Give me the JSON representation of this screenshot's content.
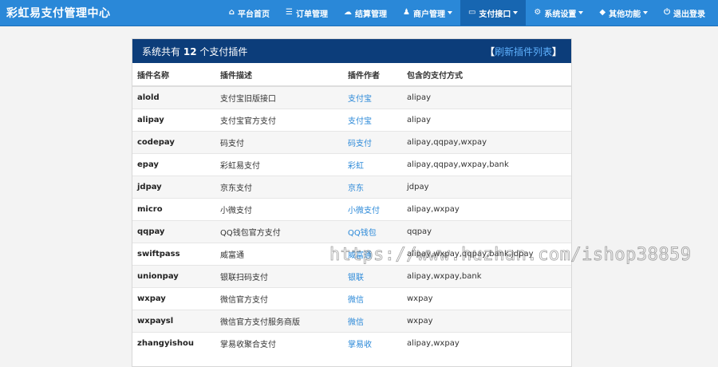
{
  "brand": "彩虹易支付管理中心",
  "nav": [
    {
      "icon": "⌂",
      "label": "平台首页",
      "caret": false,
      "active": false
    },
    {
      "icon": "☰",
      "label": "订单管理",
      "caret": false,
      "active": false
    },
    {
      "icon": "☁",
      "label": "结算管理",
      "caret": false,
      "active": false
    },
    {
      "icon": "♟",
      "label": "商户管理",
      "caret": true,
      "active": false
    },
    {
      "icon": "▭",
      "label": "支付接口",
      "caret": true,
      "active": true
    },
    {
      "icon": "⚙",
      "label": "系统设置",
      "caret": true,
      "active": false
    },
    {
      "icon": "◆",
      "label": "其他功能",
      "caret": true,
      "active": false
    },
    {
      "icon": "⏻",
      "label": "退出登录",
      "caret": false,
      "active": false
    }
  ],
  "panel": {
    "title_prefix": "系统共有",
    "count": "12",
    "title_suffix": "个支付插件",
    "refresh_open": "【",
    "refresh_label": "刷新插件列表",
    "refresh_close": "】"
  },
  "columns": [
    "插件名称",
    "插件描述",
    "插件作者",
    "包含的支付方式"
  ],
  "rows": [
    {
      "name": "alold",
      "desc": "支付宝旧版接口",
      "author": "支付宝",
      "types": "alipay"
    },
    {
      "name": "alipay",
      "desc": "支付宝官方支付",
      "author": "支付宝",
      "types": "alipay"
    },
    {
      "name": "codepay",
      "desc": "码支付",
      "author": "码支付",
      "types": "alipay,qqpay,wxpay"
    },
    {
      "name": "epay",
      "desc": "彩虹易支付",
      "author": "彩虹",
      "types": "alipay,qqpay,wxpay,bank"
    },
    {
      "name": "jdpay",
      "desc": "京东支付",
      "author": "京东",
      "types": "jdpay"
    },
    {
      "name": "micro",
      "desc": "小微支付",
      "author": "小微支付",
      "types": "alipay,wxpay"
    },
    {
      "name": "qqpay",
      "desc": "QQ钱包官方支付",
      "author": "QQ钱包",
      "types": "qqpay"
    },
    {
      "name": "swiftpass",
      "desc": "威富通",
      "author": "威富通",
      "types": "alipay,wxpay,qqpay,bank,jdpay"
    },
    {
      "name": "unionpay",
      "desc": "银联扫码支付",
      "author": "银联",
      "types": "alipay,wxpay,bank"
    },
    {
      "name": "wxpay",
      "desc": "微信官方支付",
      "author": "微信",
      "types": "wxpay"
    },
    {
      "name": "wxpaysl",
      "desc": "微信官方支付服务商版",
      "author": "微信",
      "types": "wxpay"
    },
    {
      "name": "zhangyishou",
      "desc": "掌易收聚合支付",
      "author": "掌易收",
      "types": "alipay,wxpay"
    }
  ],
  "watermark": "https://www.huzhan.com/ishop38859"
}
